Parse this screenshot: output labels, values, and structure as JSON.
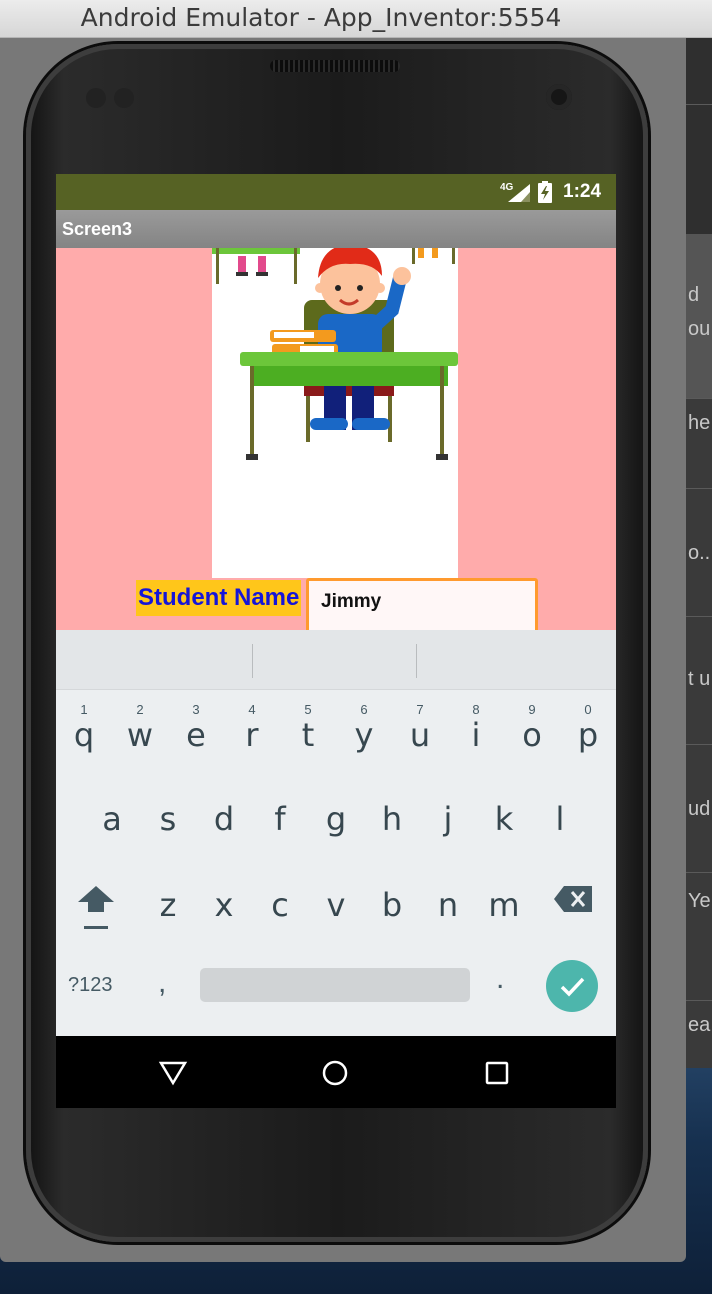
{
  "window": {
    "title": "Android Emulator - App_Inventor:5554"
  },
  "background_window": {
    "fragments": [
      "d",
      "ou",
      "he",
      "o..",
      "t u",
      "ud",
      "Ye",
      "ea"
    ]
  },
  "status_bar": {
    "network": "4G",
    "time": "1:24"
  },
  "app": {
    "screen_title": "Screen3",
    "student_label": "Student Name",
    "student_input_value": "Jimmy"
  },
  "keyboard": {
    "row1": [
      {
        "key": "q",
        "hint": "1"
      },
      {
        "key": "w",
        "hint": "2"
      },
      {
        "key": "e",
        "hint": "3"
      },
      {
        "key": "r",
        "hint": "4"
      },
      {
        "key": "t",
        "hint": "5"
      },
      {
        "key": "y",
        "hint": "6"
      },
      {
        "key": "u",
        "hint": "7"
      },
      {
        "key": "i",
        "hint": "8"
      },
      {
        "key": "o",
        "hint": "9"
      },
      {
        "key": "p",
        "hint": "0"
      }
    ],
    "row2": [
      "a",
      "s",
      "d",
      "f",
      "g",
      "h",
      "j",
      "k",
      "l"
    ],
    "row3": [
      "z",
      "x",
      "c",
      "v",
      "b",
      "n",
      "m"
    ],
    "symbols_label": "?123",
    "comma": ",",
    "period": "."
  },
  "colors": {
    "screen_bg": "#ffabab",
    "status_bar": "#566224",
    "label_bg": "#ffc61a",
    "label_text": "#1515d8",
    "input_border": "#ff9a2e",
    "enter_key": "#4db6ac"
  },
  "icons": {
    "signal": "signal-icon",
    "battery": "battery-charging-icon",
    "shift": "shift-icon",
    "backspace": "backspace-icon",
    "enter": "check-icon",
    "back": "triangle-back-icon",
    "home": "circle-home-icon",
    "recents": "square-recents-icon"
  }
}
